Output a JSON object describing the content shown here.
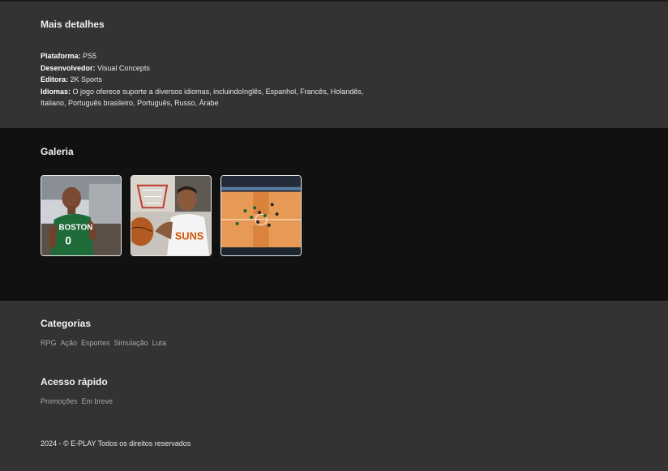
{
  "details": {
    "title": "Mais detalhes",
    "platform_label": "Plataforma:",
    "platform_value": " PS5",
    "developer_label": "Desenvolvedor:",
    "developer_value": " Visual Concepts",
    "publisher_label": "Editora:",
    "publisher_value": " 2K Sports",
    "languages_label": "Idiomas:",
    "languages_value": " O jogo oferece suporte a diversos idiomas, incluindoInglês, Espanhol, Francês, Holandês, Italiano, Português brasileiro, Português, Russo, Árabe"
  },
  "gallery": {
    "title": "Galeria",
    "images": [
      {
        "alt": "Boston player"
      },
      {
        "alt": "Suns player"
      },
      {
        "alt": "Basketball court"
      }
    ]
  },
  "footer": {
    "categories_title": "Categorias",
    "categories": [
      "RPG",
      "Ação",
      "Esportes",
      "Simulação",
      "Luta"
    ],
    "quick_title": "Acesso rápido",
    "quick_links": [
      "Promoções",
      "Em breve"
    ],
    "copyright": "2024 - © E-PLAY Todos os direitos reservados"
  }
}
